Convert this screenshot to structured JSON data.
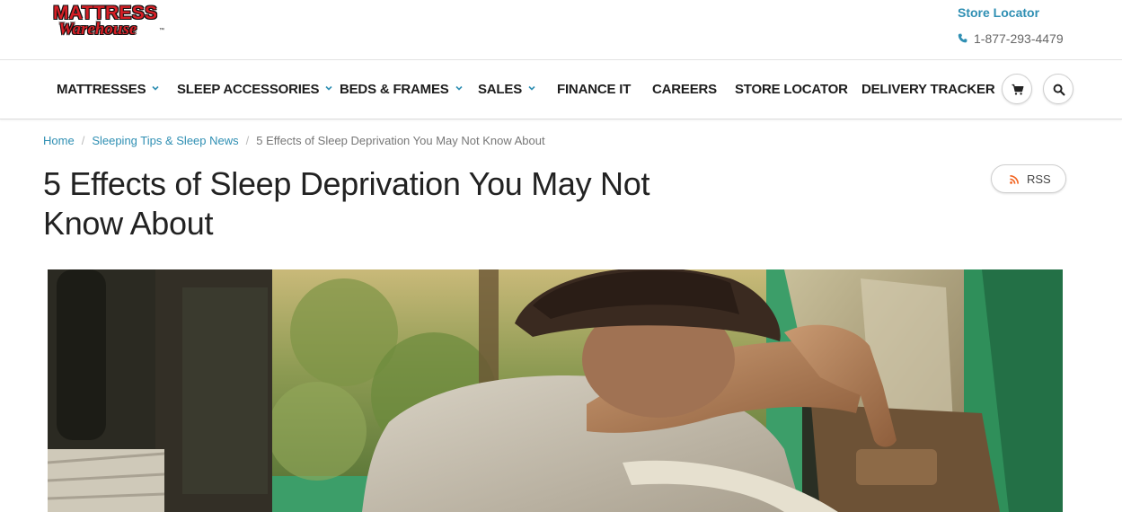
{
  "logo": {
    "line1": "MATTRESS",
    "line2": "Warehouse",
    "tm": "™"
  },
  "header": {
    "store_locator": "Store Locator",
    "phone": "1-877-293-4479"
  },
  "nav": {
    "items": [
      {
        "label": "MATTRESSES",
        "has_dropdown": true
      },
      {
        "label": "SLEEP ACCESSORIES",
        "has_dropdown": true
      },
      {
        "label": "BEDS & FRAMES",
        "has_dropdown": true
      },
      {
        "label": "SALES",
        "has_dropdown": true
      },
      {
        "label": "FINANCE IT",
        "has_dropdown": false
      },
      {
        "label": "CAREERS",
        "has_dropdown": false
      },
      {
        "label": "STORE LOCATOR",
        "has_dropdown": false
      },
      {
        "label": "DELIVERY TRACKER",
        "has_dropdown": false
      }
    ],
    "icons": [
      "cart-icon",
      "search-icon"
    ]
  },
  "breadcrumb": {
    "home": "Home",
    "category": "Sleeping Tips & Sleep News",
    "current": "5 Effects of Sleep Deprivation You May Not Know About"
  },
  "article": {
    "title": "5 Effects of Sleep Deprivation You May Not Know About",
    "rss_label": "RSS"
  },
  "colors": {
    "accent": "#2f8fb3",
    "logo_red": "#d61f26",
    "rss_orange": "#f26522"
  }
}
